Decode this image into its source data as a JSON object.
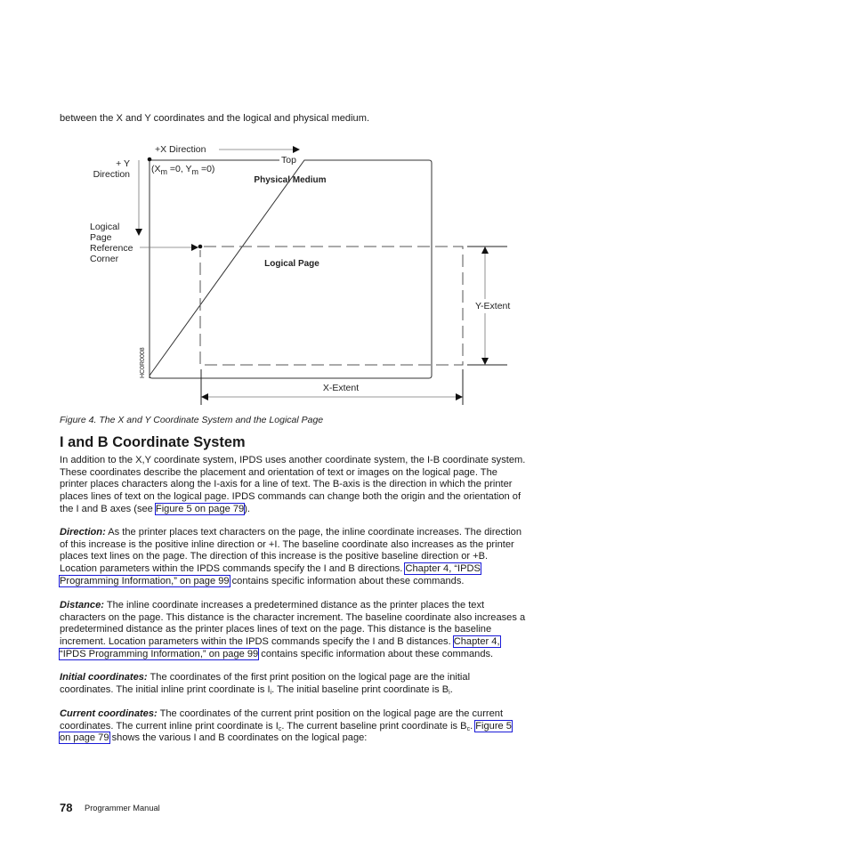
{
  "intro_text": "between the X and Y coordinates and the logical and physical medium.",
  "figure": {
    "x_direction_label": "+X Direction",
    "top_label": "Top",
    "y_direction_label_1": "+ Y",
    "y_direction_label_2": "Direction",
    "origin_label_prefix": "(X",
    "origin_label_sub1": "m",
    "origin_label_mid": " =0,  Y",
    "origin_label_sub2": "m",
    "origin_label_suffix": " =0)",
    "physical_medium_label": "Physical Medium",
    "logical_page_label": "Logical Page",
    "ref_corner_lines": [
      "Logical",
      "Page",
      "Reference",
      "Corner"
    ],
    "y_extent_label": "Y-Extent",
    "x_extent_label": "X-Extent",
    "figure_id": "HC0R0008",
    "caption": "Figure 4. The X and Y Coordinate System and the Logical Page"
  },
  "section": {
    "heading": "I and B Coordinate System",
    "p1": {
      "l1": "In addition to the X,Y coordinate system, IPDS uses another coordinate system, the I-B coordinate system.",
      "l2": "These coordinates describe the placement and orientation of text or images on the logical page. The",
      "l3": "printer places characters along the I-axis for a line of text. The B-axis is the direction in which the printer",
      "l4": "places lines of text on the logical page. IPDS commands can change both the origin and the orientation of",
      "l5_pre": "the I and B axes (see ",
      "l5_link": "Figure 5 on page 79",
      "l5_post": ")."
    },
    "p2": {
      "term": "Direction:",
      "l1": " As the printer places text characters on the page, the inline coordinate increases. The direction",
      "l2": "of this increase is the positive inline direction or +I. The baseline coordinate also increases as the printer",
      "l3": "places text lines on the page. The direction of this increase is the positive baseline direction or +B.",
      "l4_pre": "Location parameters within the IPDS commands specify the I and B directions. ",
      "l4_link": "Chapter 4, “IPDS",
      "l5_link": "Programming Information,” on page 99",
      "l5_post": " contains specific information about these commands."
    },
    "p3": {
      "term": "Distance:",
      "l1": " The inline coordinate increases a predetermined distance as the printer places the text",
      "l2": "characters on the page. This distance is the character increment. The baseline coordinate also increases a",
      "l3": "predetermined distance as the printer places lines of text on the page. This distance is the baseline",
      "l4_pre": "increment. Location parameters within the IPDS commands specify the I and B distances. ",
      "l4_link": "Chapter 4,",
      "l5_link": "“IPDS Programming Information,” on page 99",
      "l5_post": " contains specific information about these commands."
    },
    "p4": {
      "term": "Initial coordinates:",
      "l1": " The coordinates of the first print position on the logical page are the initial",
      "l2_a": "coordinates. The initial inline print coordinate is I",
      "l2_sub1": "i",
      "l2_b": ". The initial baseline print coordinate is B",
      "l2_sub2": "i",
      "l2_c": "."
    },
    "p5": {
      "term": "Current coordinates:",
      "l1": " The coordinates of the current print position on the logical page are the current",
      "l2_a": "coordinates. The current inline print coordinate is I",
      "l2_sub1": "c",
      "l2_b": ". The current baseline print coordinate is B",
      "l2_sub2": "c",
      "l2_c": ". ",
      "l2_link": "Figure 5",
      "l3_link": "on page 79",
      "l3_post": " shows the various I and B coordinates on the logical page:"
    }
  },
  "footer": {
    "page_number": "78",
    "manual_title": "Programmer Manual"
  },
  "colors": {
    "link_box": "#1b1bd8",
    "text": "#1a1a1a"
  }
}
